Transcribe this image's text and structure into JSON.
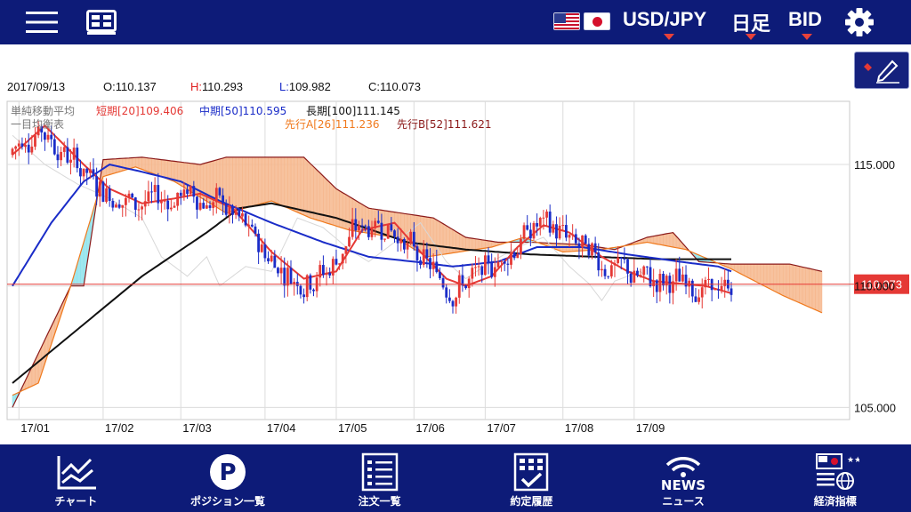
{
  "header": {
    "currency_pair": "USD/JPY",
    "timeframe": "日足",
    "price_type": "BID"
  },
  "info": {
    "date": "2017/09/13",
    "open_label": "O:",
    "open": "110.137",
    "high_label": "H:",
    "high": "110.293",
    "low_label": "L:",
    "low": "109.982",
    "close_label": "C:",
    "close": "110.073"
  },
  "chart_data": {
    "type": "candlestick",
    "ylim": [
      104.5,
      117.6
    ],
    "y_ticks": [
      {
        "value": 115.0,
        "label": "115.000"
      },
      {
        "value": 110.0,
        "label": "110.000"
      },
      {
        "value": 105.0,
        "label": "105.000"
      }
    ],
    "x_ticks": [
      "17/01",
      "17/02",
      "17/03",
      "17/04",
      "17/05",
      "17/06",
      "17/07",
      "17/08",
      "17/09"
    ],
    "current_price": {
      "value": 110.073,
      "label": "110.073",
      "color": "#e53935"
    },
    "legend_sma": {
      "title": "単純移動平均",
      "items": [
        {
          "text": "短期[20]109.406",
          "color": "#e53935"
        },
        {
          "text": "中期[50]110.595",
          "color": "#1a2cc8"
        },
        {
          "text": "長期[100]111.145",
          "color": "#111111"
        }
      ]
    },
    "legend_ichimoku": {
      "title": "一目均衡表",
      "items": [
        {
          "text": "先行A[26]111.236",
          "color": "#f07a1e"
        },
        {
          "text": "先行B[52]111.621",
          "color": "#8b1a1a"
        }
      ]
    },
    "series_keypoints": {
      "short_ma_20": [
        [
          0,
          115.4
        ],
        [
          10,
          116.6
        ],
        [
          22,
          115.0
        ],
        [
          30,
          114.0
        ],
        [
          40,
          113.4
        ],
        [
          50,
          113.6
        ],
        [
          58,
          113.8
        ],
        [
          68,
          113.2
        ],
        [
          80,
          111.4
        ],
        [
          90,
          110.3
        ],
        [
          100,
          110.6
        ],
        [
          108,
          112.3
        ],
        [
          118,
          112.6
        ],
        [
          126,
          111.4
        ],
        [
          134,
          110.3
        ],
        [
          140,
          110.0
        ],
        [
          148,
          110.4
        ],
        [
          156,
          111.6
        ],
        [
          164,
          112.5
        ],
        [
          172,
          112.2
        ],
        [
          182,
          111.2
        ],
        [
          190,
          110.6
        ],
        [
          198,
          110.2
        ],
        [
          206,
          110.1
        ],
        [
          214,
          110.0
        ],
        [
          222,
          109.7
        ]
      ],
      "mid_ma_50": [
        [
          0,
          110.0
        ],
        [
          12,
          112.6
        ],
        [
          22,
          114.3
        ],
        [
          30,
          115.0
        ],
        [
          40,
          114.7
        ],
        [
          52,
          114.3
        ],
        [
          64,
          113.5
        ],
        [
          80,
          112.6
        ],
        [
          96,
          111.8
        ],
        [
          110,
          111.2
        ],
        [
          124,
          111.0
        ],
        [
          136,
          110.8
        ],
        [
          150,
          111.0
        ],
        [
          162,
          111.6
        ],
        [
          176,
          111.6
        ],
        [
          190,
          111.3
        ],
        [
          206,
          111.0
        ],
        [
          218,
          110.8
        ],
        [
          222,
          110.6
        ]
      ],
      "long_ma_100": [
        [
          0,
          106.0
        ],
        [
          20,
          108.2
        ],
        [
          40,
          110.4
        ],
        [
          60,
          112.2
        ],
        [
          70,
          113.2
        ],
        [
          80,
          113.4
        ],
        [
          100,
          112.8
        ],
        [
          122,
          111.8
        ],
        [
          140,
          111.5
        ],
        [
          160,
          111.3
        ],
        [
          180,
          111.2
        ],
        [
          200,
          111.1
        ],
        [
          222,
          111.1
        ]
      ],
      "senkou_a_26": [
        [
          0,
          105.5
        ],
        [
          8,
          106.0
        ],
        [
          18,
          110.0
        ],
        [
          28,
          114.5
        ],
        [
          38,
          114.9
        ],
        [
          50,
          114.3
        ],
        [
          66,
          113.0
        ],
        [
          80,
          113.5
        ],
        [
          92,
          112.8
        ],
        [
          104,
          112.3
        ],
        [
          118,
          112.0
        ],
        [
          128,
          111.2
        ],
        [
          138,
          111.4
        ],
        [
          148,
          111.6
        ],
        [
          158,
          112.0
        ],
        [
          170,
          111.4
        ],
        [
          182,
          111.5
        ],
        [
          196,
          111.8
        ],
        [
          208,
          111.5
        ],
        [
          222,
          110.7
        ],
        [
          238,
          109.6
        ],
        [
          250,
          108.9
        ]
      ],
      "senkou_b_52": [
        [
          0,
          105.0
        ],
        [
          18,
          110.0
        ],
        [
          22,
          110.0
        ],
        [
          28,
          115.2
        ],
        [
          40,
          115.3
        ],
        [
          58,
          115.0
        ],
        [
          66,
          115.3
        ],
        [
          90,
          115.3
        ],
        [
          100,
          114.0
        ],
        [
          110,
          113.2
        ],
        [
          130,
          112.8
        ],
        [
          140,
          112.0
        ],
        [
          150,
          111.8
        ],
        [
          160,
          111.8
        ],
        [
          176,
          111.7
        ],
        [
          186,
          111.5
        ],
        [
          196,
          112.0
        ],
        [
          204,
          112.2
        ],
        [
          212,
          111.0
        ],
        [
          222,
          110.9
        ],
        [
          240,
          110.9
        ],
        [
          250,
          110.6
        ]
      ],
      "chikou_26": [
        [
          0,
          116.2
        ],
        [
          10,
          115.0
        ],
        [
          20,
          114.2
        ],
        [
          30,
          113.6
        ],
        [
          40,
          112.8
        ],
        [
          46,
          111.2
        ],
        [
          54,
          110.4
        ],
        [
          60,
          111.2
        ],
        [
          64,
          110.0
        ],
        [
          72,
          110.8
        ],
        [
          80,
          110.6
        ],
        [
          88,
          112.8
        ],
        [
          96,
          112.4
        ],
        [
          104,
          111.5
        ],
        [
          110,
          111.0
        ],
        [
          120,
          112.0
        ],
        [
          126,
          112.6
        ],
        [
          134,
          111.0
        ],
        [
          140,
          110.3
        ],
        [
          148,
          111.0
        ],
        [
          156,
          111.6
        ],
        [
          164,
          112.0
        ],
        [
          172,
          110.8
        ],
        [
          178,
          110.1
        ],
        [
          182,
          109.4
        ],
        [
          186,
          110.2
        ],
        [
          194,
          110.6
        ],
        [
          198,
          110.0
        ]
      ]
    }
  },
  "nav": [
    {
      "id": "chart",
      "label": "チャート"
    },
    {
      "id": "positions",
      "label": "ポジション一覧"
    },
    {
      "id": "orders",
      "label": "注文一覧"
    },
    {
      "id": "history",
      "label": "約定履歴"
    },
    {
      "id": "news",
      "label": "ニュース",
      "badge": "NEWS"
    },
    {
      "id": "indicators",
      "label": "経済指標"
    }
  ]
}
